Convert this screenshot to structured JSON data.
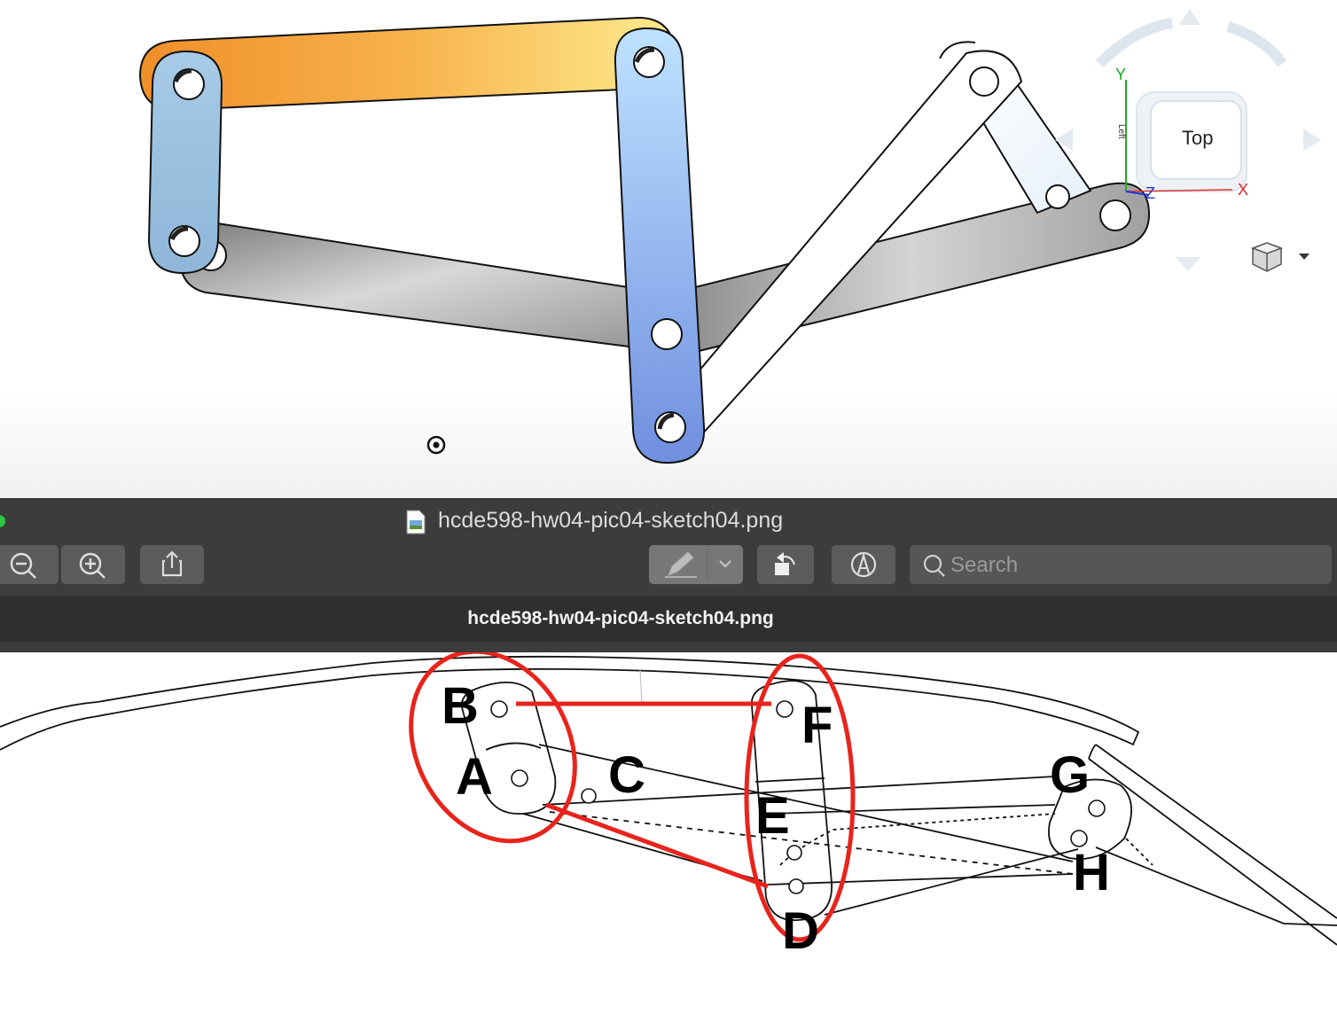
{
  "viewport": {
    "view_cube": {
      "face_label": "Top",
      "side_label": "Left"
    },
    "axes": {
      "x": "X",
      "y": "Y",
      "z": "Z"
    }
  },
  "window": {
    "title": "hcde598-hw04-pic04-sketch04.png",
    "tab_title": "hcde598-hw04-pic04-sketch04.png",
    "search": {
      "placeholder": "Search",
      "value": ""
    }
  },
  "toolbar": {
    "buttons": [
      "zoom-out-icon",
      "zoom-in-icon",
      "share-icon",
      "markup-pen-icon",
      "chevron-down-icon",
      "rotate-icon",
      "markup-icon"
    ]
  },
  "sketch": {
    "labels": {
      "a": "A",
      "b": "B",
      "c": "C",
      "d": "D",
      "e": "E",
      "f": "F",
      "g": "G",
      "h": "H"
    },
    "annotation_color": "#e8241c"
  },
  "colors": {
    "link_orange": "#f6a140",
    "link_yellow": "#fde98a",
    "link_blue_light": "#b6dcff",
    "link_blue_dark": "#7a9ae6",
    "link_gray": "#a8a8a8",
    "window_bg": "#3c3c3c"
  }
}
